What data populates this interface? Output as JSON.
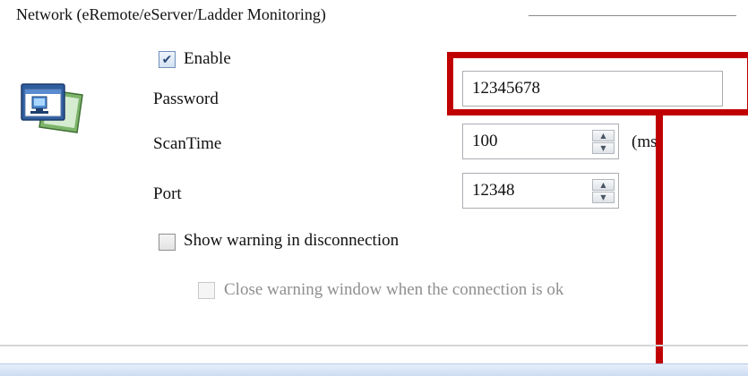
{
  "group": {
    "title": "Network (eRemote/eServer/Ladder Monitoring)"
  },
  "icon": {
    "name": "network-monitor-icon"
  },
  "enable": {
    "label": "Enable",
    "checked": true
  },
  "password": {
    "label": "Password",
    "value": "12345678"
  },
  "scantime": {
    "label": "ScanTime",
    "value": "100",
    "unit": "(ms)"
  },
  "port": {
    "label": "Port",
    "value": "12348"
  },
  "show_warning": {
    "label": "Show warning in disconnection",
    "checked": false
  },
  "close_warning": {
    "label": "Close warning window when the connection is ok",
    "checked": false,
    "enabled": false
  },
  "spin": {
    "up": "▲",
    "down": "▼"
  },
  "check_glyph": "✔",
  "colors": {
    "highlight": "#c00000",
    "accent": "#3d6aa8"
  }
}
